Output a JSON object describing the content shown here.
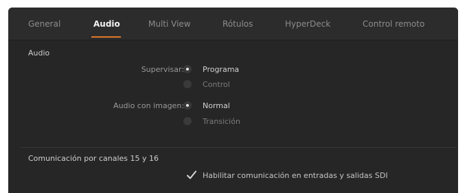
{
  "tabs": [
    {
      "label": "General",
      "active": false
    },
    {
      "label": "Audio",
      "active": true
    },
    {
      "label": "Multi View",
      "active": false
    },
    {
      "label": "Rótulos",
      "active": false
    },
    {
      "label": "HyperDeck",
      "active": false
    },
    {
      "label": "Control remoto",
      "active": false
    }
  ],
  "audio_section": {
    "title": "Audio",
    "monitor": {
      "label": "Supervisar:",
      "options": [
        "Programa",
        "Control"
      ],
      "selected": "Programa"
    },
    "audio_follow_video": {
      "label": "Audio con imagen:",
      "options": [
        "Normal",
        "Transición"
      ],
      "selected": "Normal"
    }
  },
  "talkback_section": {
    "title": "Comunicación por canales 15 y 16",
    "checkbox_label": "Habilitar comunicación en entradas y salidas SDI",
    "checked": true
  },
  "colors": {
    "accent": "#e0782a",
    "background": "#262626",
    "tab_bar": "#2c2c2c"
  }
}
